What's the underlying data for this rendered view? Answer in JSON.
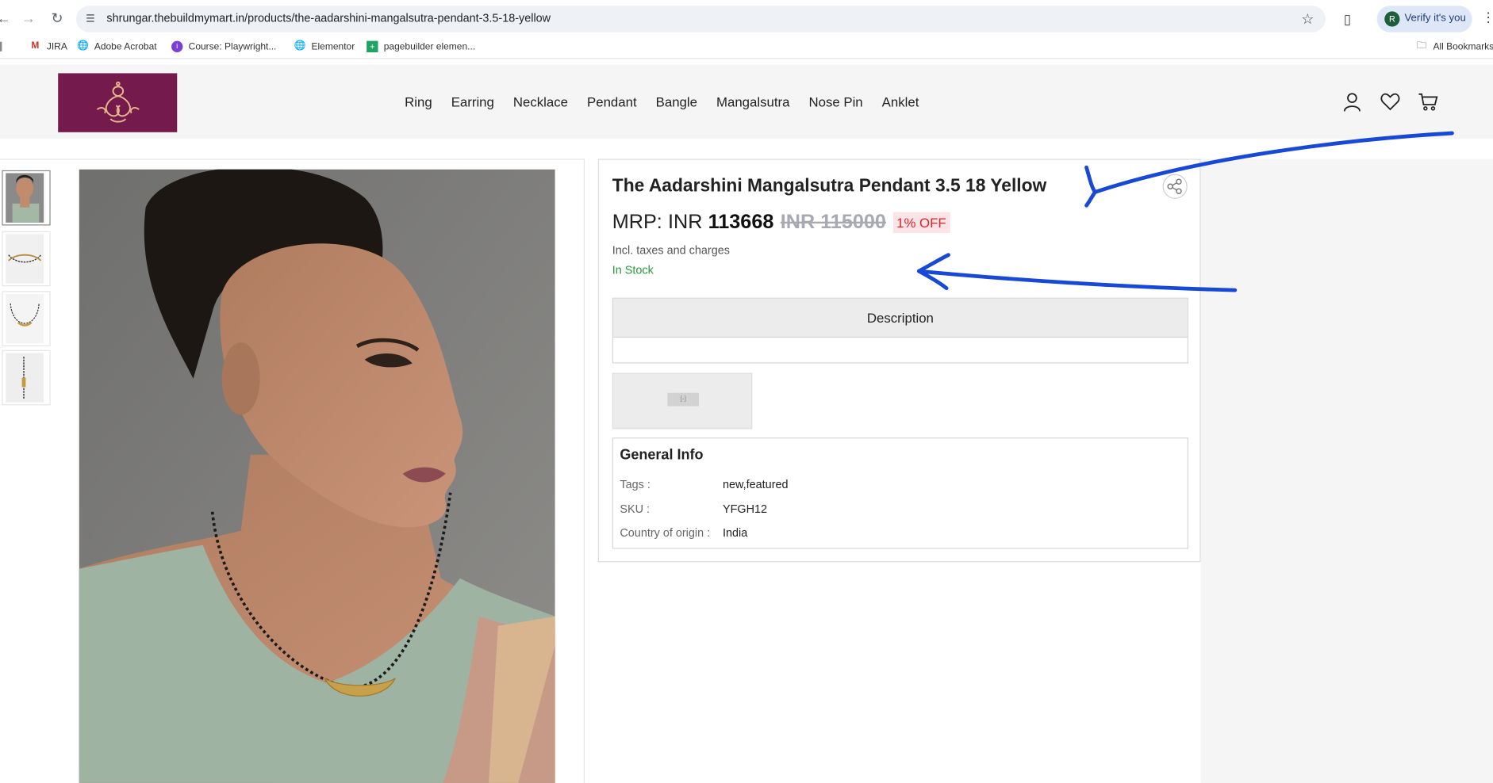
{
  "browser": {
    "url": "shrungar.thebuildmymart.in/products/the-aadarshini-mangalsutra-pendant-3.5-18-yellow",
    "profile_initial": "R",
    "verify_label": "Verify it's you",
    "bookmarks": [
      "JIRA",
      "Adobe Acrobat",
      "Course: Playwright...",
      "Elementor",
      "pagebuilder elemen..."
    ],
    "all_bookmarks": "All Bookmarks"
  },
  "site": {
    "nav": [
      "Ring",
      "Earring",
      "Necklace",
      "Pendant",
      "Bangle",
      "Mangalsutra",
      "Nose Pin",
      "Anklet"
    ]
  },
  "product": {
    "title": "The Aadarshini Mangalsutra Pendant 3.5 18 Yellow",
    "mrp_label": "MRP:",
    "currency": "INR",
    "price": "113668",
    "old_price": "INR 115000",
    "discount": "1% OFF",
    "taxes_note": "Incl. taxes and charges",
    "stock_status": "In Stock",
    "description_tab": "Description",
    "general_info": {
      "title": "General Info",
      "rows": [
        {
          "key": "Tags :",
          "value": "new,featured"
        },
        {
          "key": "SKU :",
          "value": "YFGH12"
        },
        {
          "key": "Country of origin :",
          "value": "India"
        }
      ]
    }
  },
  "colors": {
    "brand": "#741a4c",
    "stock_green": "#2b9a3f",
    "discount_red": "#d8272f",
    "annotation_blue": "#1749d6"
  }
}
